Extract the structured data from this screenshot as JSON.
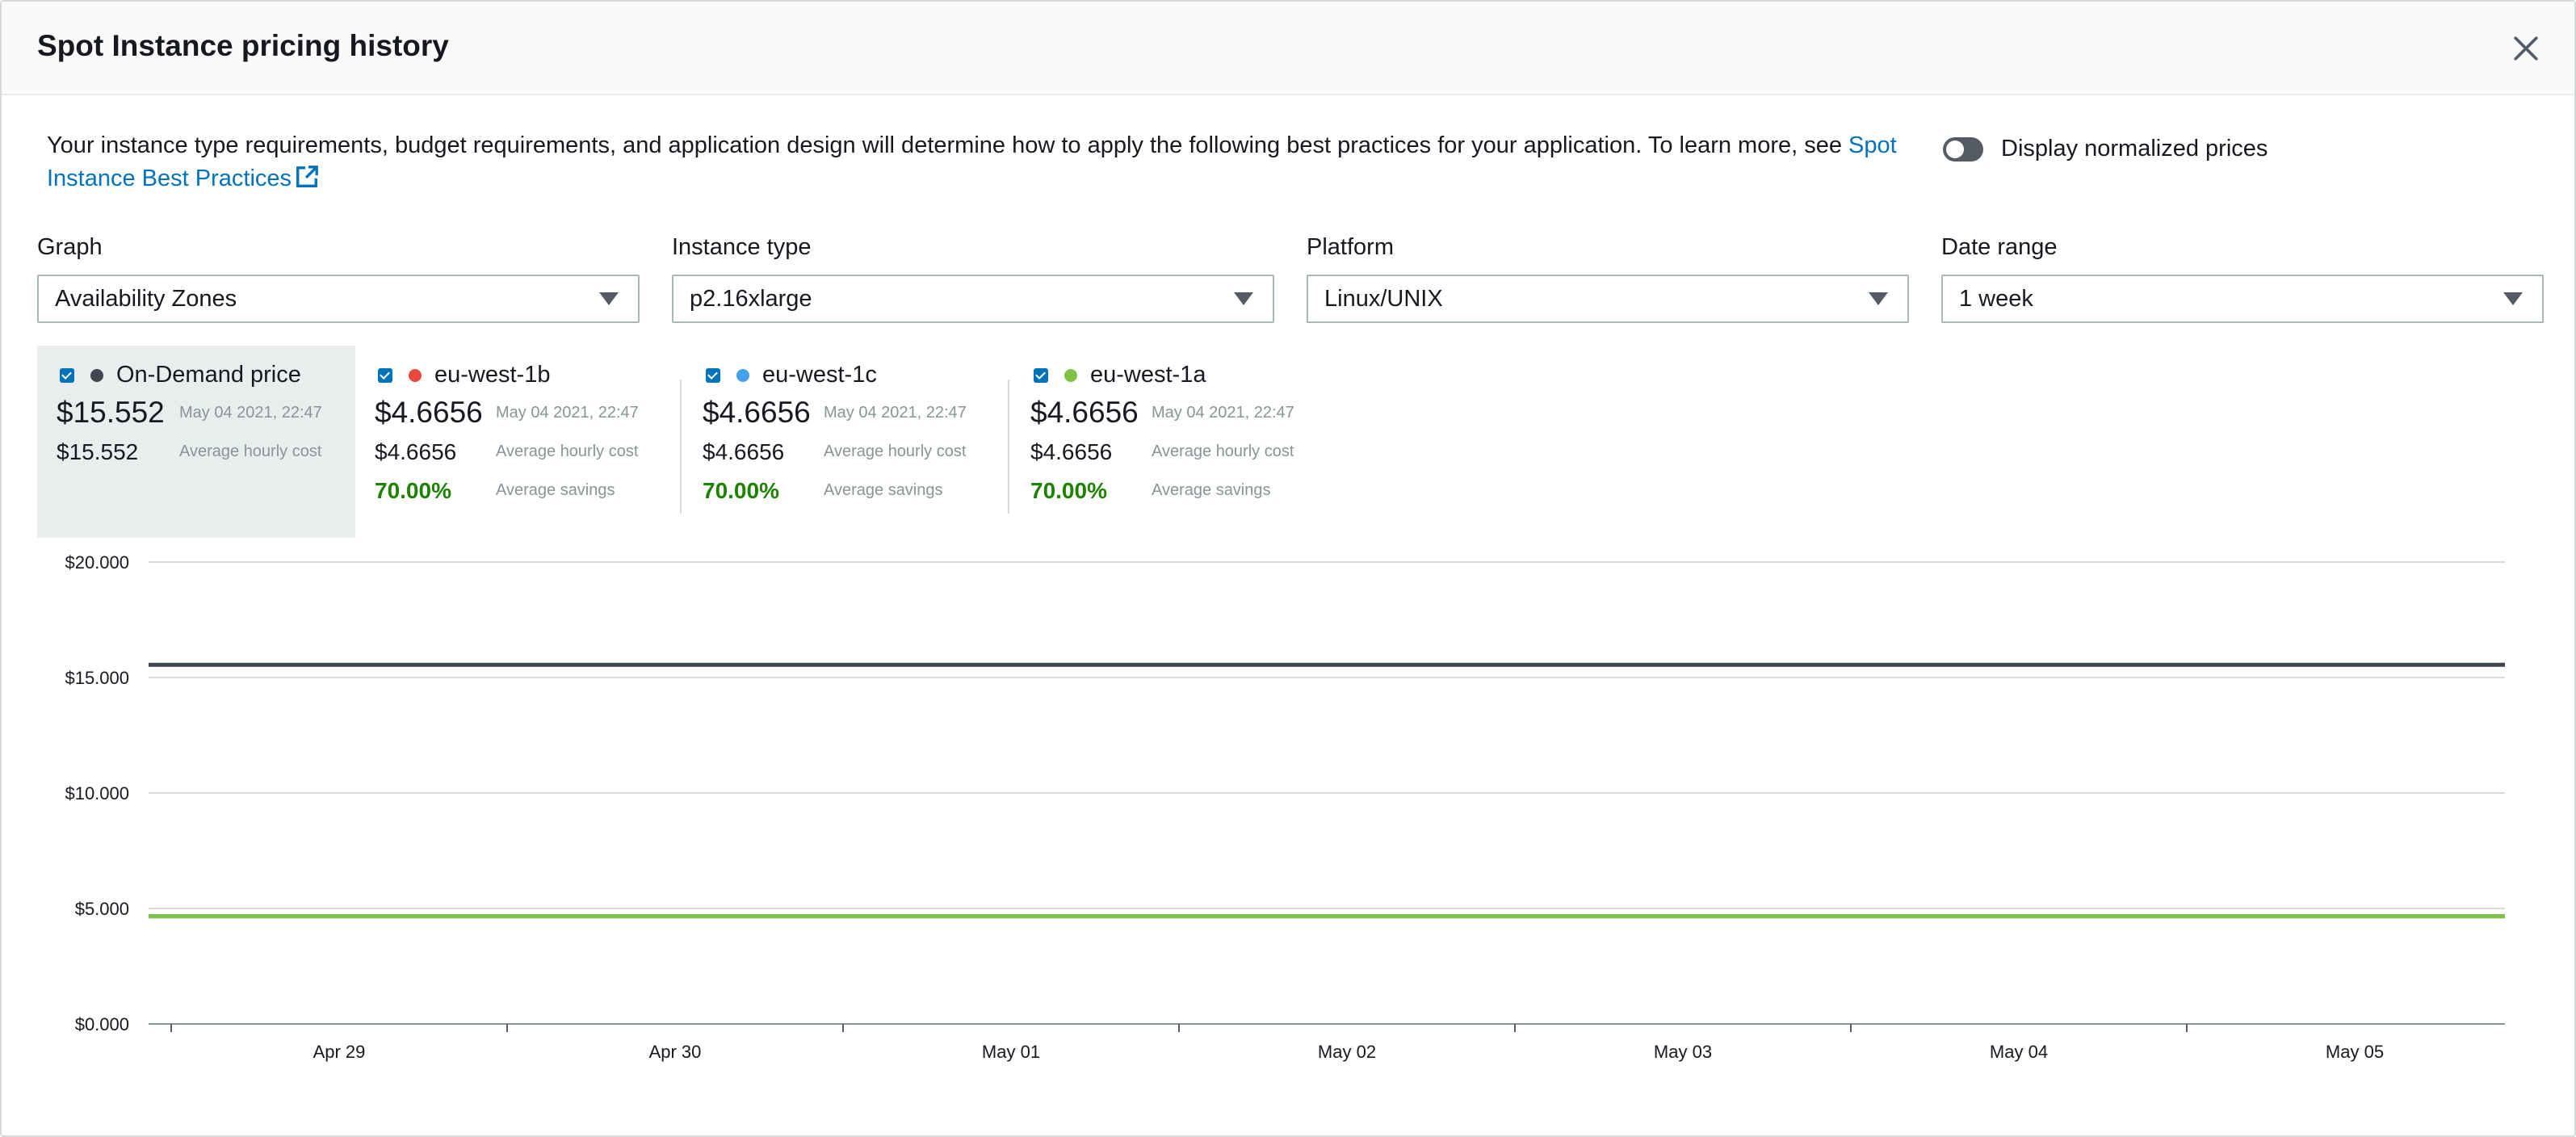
{
  "modal": {
    "title": "Spot Instance pricing history",
    "close_icon": "close-icon"
  },
  "intro": {
    "text": "Your instance type requirements, budget requirements, and application design will determine how to apply the following best practices for your application. To learn more, see ",
    "link_text": "Spot Instance Best Practices",
    "link_icon": "external-link-icon"
  },
  "toggle": {
    "label": "Display normalized prices",
    "on": false
  },
  "filters": {
    "graph": {
      "label": "Graph",
      "value": "Availability Zones"
    },
    "instance_type": {
      "label": "Instance type",
      "value": "p2.16xlarge"
    },
    "platform": {
      "label": "Platform",
      "value": "Linux/UNIX"
    },
    "date_range": {
      "label": "Date range",
      "value": "1 week"
    }
  },
  "legend": [
    {
      "name": "On-Demand price",
      "color": "#414750",
      "price": "$15.552",
      "timestamp": "May 04 2021, 22:47",
      "avg_cost": "$15.552",
      "avg_cost_label": "Average hourly cost"
    },
    {
      "name": "eu-west-1b",
      "color": "#e7493e",
      "price": "$4.6656",
      "timestamp": "May 04 2021, 22:47",
      "avg_cost": "$4.6656",
      "avg_cost_label": "Average hourly cost",
      "savings": "70.00%",
      "savings_label": "Average savings"
    },
    {
      "name": "eu-west-1c",
      "color": "#44a3e8",
      "price": "$4.6656",
      "timestamp": "May 04 2021, 22:47",
      "avg_cost": "$4.6656",
      "avg_cost_label": "Average hourly cost",
      "savings": "70.00%",
      "savings_label": "Average savings"
    },
    {
      "name": "eu-west-1a",
      "color": "#7dc247",
      "price": "$4.6656",
      "timestamp": "May 04 2021, 22:47",
      "avg_cost": "$4.6656",
      "avg_cost_label": "Average hourly cost",
      "savings": "70.00%",
      "savings_label": "Average savings"
    }
  ],
  "chart_data": {
    "type": "line",
    "title": "",
    "xlabel": "",
    "ylabel": "",
    "ylim": [
      0,
      20
    ],
    "yticks": [
      0,
      5,
      10,
      15,
      20
    ],
    "ytick_labels": [
      "$0.000",
      "$5.000",
      "$10.000",
      "$15.000",
      "$20.000"
    ],
    "xtick_labels": [
      "Apr 29",
      "Apr 30",
      "May 01",
      "May 02",
      "May 03",
      "May 04",
      "May 05"
    ],
    "grid": true,
    "series": [
      {
        "name": "On-Demand price",
        "color": "#414750",
        "values": [
          15.552,
          15.552,
          15.552,
          15.552,
          15.552,
          15.552,
          15.552,
          15.552
        ]
      },
      {
        "name": "eu-west-1b",
        "color": "#e7493e",
        "values": [
          4.6656,
          4.6656,
          4.6656,
          4.6656,
          4.6656,
          4.6656,
          4.6656,
          4.6656
        ]
      },
      {
        "name": "eu-west-1c",
        "color": "#44a3e8",
        "values": [
          4.6656,
          4.6656,
          4.6656,
          4.6656,
          4.6656,
          4.6656,
          4.6656,
          4.6656
        ]
      },
      {
        "name": "eu-west-1a",
        "color": "#7dc247",
        "values": [
          4.6656,
          4.6656,
          4.6656,
          4.6656,
          4.6656,
          4.6656,
          4.6656,
          4.6656
        ]
      }
    ]
  }
}
